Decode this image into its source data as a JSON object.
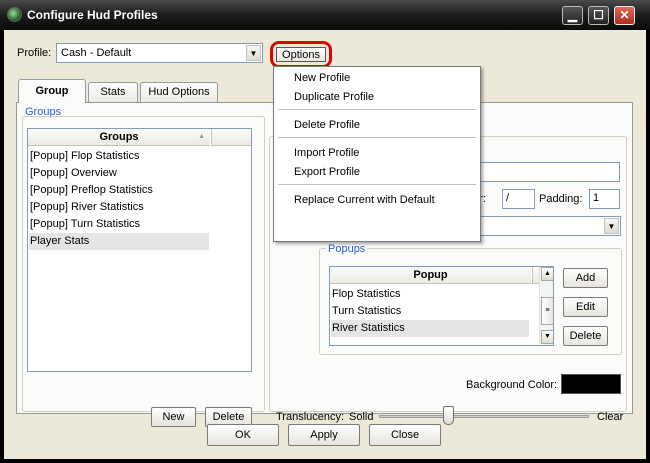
{
  "window": {
    "title": "Configure Hud Profiles",
    "controls": {
      "minimize": "▁",
      "maximize": "☐",
      "close": "✕"
    }
  },
  "profile": {
    "label": "Profile:",
    "value": "Cash - Default",
    "options_label": "Options"
  },
  "options_menu": {
    "items": [
      "New Profile",
      "Duplicate Profile",
      "Delete Profile",
      "Import Profile",
      "Export Profile",
      "Replace Current with Default"
    ]
  },
  "tabs": [
    {
      "label": "Group",
      "active": true
    },
    {
      "label": "Stats",
      "active": false
    },
    {
      "label": "Hud Options",
      "active": false
    }
  ],
  "groups": {
    "title": "Groups",
    "column_header": "Groups",
    "rows": [
      "[Popup] Flop Statistics",
      "[Popup] Overview",
      "[Popup] Preflop Statistics",
      "[Popup] River Statistics",
      "[Popup] Turn Statistics",
      "Player Stats"
    ],
    "selected_index": 5,
    "new_label": "New",
    "delete_label": "Delete"
  },
  "settings": {
    "separator_label_partial": "tor:",
    "separator_value": "/",
    "padding_label": "Padding:",
    "padding_value": "1"
  },
  "popups": {
    "title": "Popups",
    "column_header": "Popup",
    "rows": [
      "Flop Statistics",
      "Turn Statistics",
      "River Statistics"
    ],
    "selected_index": 2,
    "add_label": "Add",
    "edit_label": "Edit",
    "delete_label": "Delete"
  },
  "background": {
    "label": "Background Color:",
    "color": "#000000"
  },
  "translucency": {
    "label": "Translucency:",
    "min_label": "Solid",
    "max_label": "Clear",
    "level": 0.33
  },
  "footer": {
    "ok_label": "OK",
    "apply_label": "Apply",
    "close_label": "Close"
  },
  "colors": {
    "highlight_ring": "#e00000",
    "group_title": "#2a5bd7",
    "window_bg": "#ece9d8"
  }
}
